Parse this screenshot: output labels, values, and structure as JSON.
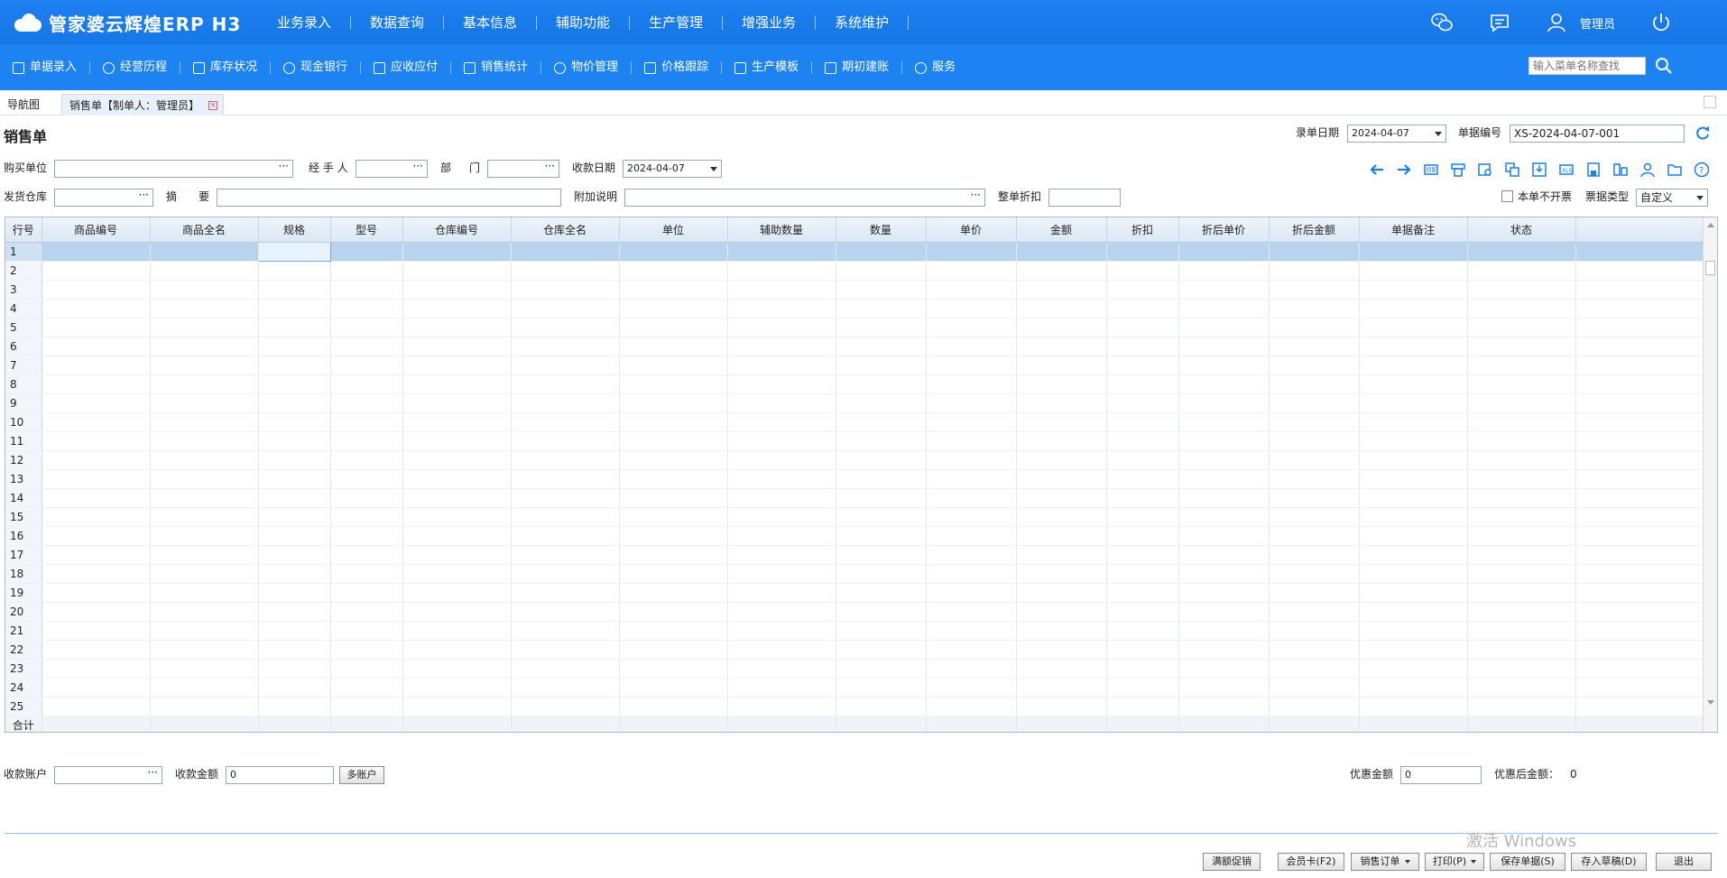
{
  "logo": {
    "text": "管家婆云辉煌ERP H3"
  },
  "top_menu": [
    "业务录入",
    "数据查询",
    "基本信息",
    "辅助功能",
    "生产管理",
    "增强业务",
    "系统维护"
  ],
  "top_right": {
    "user": "管理员"
  },
  "toolbar": [
    "单据录入",
    "经营历程",
    "库存状况",
    "现金银行",
    "应收应付",
    "销售统计",
    "物价管理",
    "价格跟踪",
    "生产模板",
    "期初建账",
    "服务"
  ],
  "menu_search": {
    "placeholder": "输入菜单名称查找"
  },
  "tabs": {
    "nav": "导航图",
    "active": "销售单【制单人：管理员】"
  },
  "form": {
    "title": "销售单",
    "entry_date_label": "录单日期",
    "entry_date": "2024-04-07",
    "doc_no_label": "单据编号",
    "doc_no": "XS-2024-04-07-001",
    "buyer_label": "购买单位",
    "handler_label": "经 手 人",
    "dept_label_1": "部",
    "dept_label_2": "门",
    "collect_date_label": "收款日期",
    "collect_date": "2024-04-07",
    "warehouse_label": "发货仓库",
    "summary_label_1": "摘",
    "summary_label_2": "要",
    "extra_label": "附加说明",
    "discount_label": "整单折扣",
    "no_invoice_label": "本单不开票",
    "invoice_type_label": "票据类型",
    "invoice_type": "自定义"
  },
  "grid": {
    "columns": [
      "行号",
      "商品编号",
      "商品全名",
      "规格",
      "型号",
      "仓库编号",
      "仓库全名",
      "单位",
      "辅助数量",
      "数量",
      "单价",
      "金额",
      "折扣",
      "折后单价",
      "折后金额",
      "单据备注",
      "状态"
    ],
    "rows": [
      "1",
      "2",
      "3",
      "4",
      "5",
      "6",
      "7",
      "8",
      "9",
      "10",
      "11",
      "12",
      "13",
      "14",
      "15",
      "16",
      "17",
      "18",
      "19",
      "20",
      "21",
      "22",
      "23",
      "24",
      "25"
    ],
    "sum_label": "合计"
  },
  "footer": {
    "account_label": "收款账户",
    "amount_label": "收款金额",
    "amount": "0",
    "multi_account": "多账户",
    "discount_amount_label": "优惠金额",
    "discount_amount": "0",
    "after_discount_label": "优惠后金额：",
    "after_discount": "0"
  },
  "buttons": [
    "满额促销",
    "会员卡(F2)",
    "销售订单",
    "打印(P)",
    "保存单据(S)",
    "存入草稿(D)",
    "退出"
  ],
  "watermark": "激活 Windows"
}
